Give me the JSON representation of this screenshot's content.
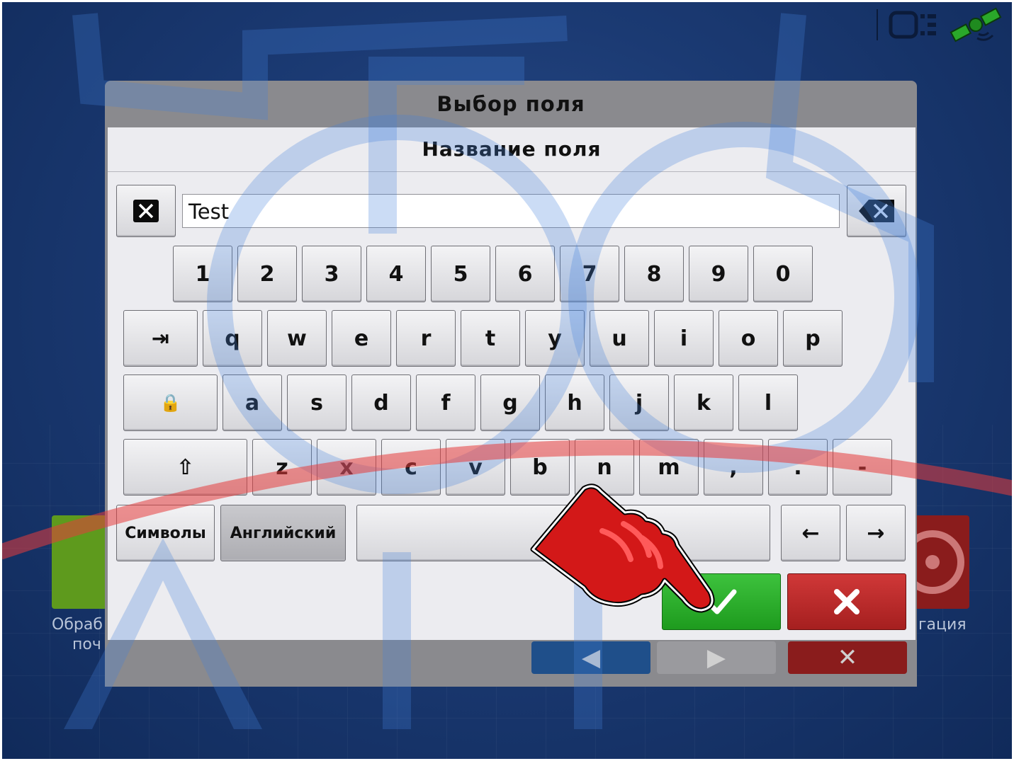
{
  "status_icons": [
    "display-icon",
    "satellite-signal-icon"
  ],
  "background": {
    "left_tile_label_line1": "Обраб",
    "left_tile_label_line2": "поч",
    "right_tile_label": "гация",
    "footer_prev_glyph": "◀",
    "footer_next_glyph": "▶",
    "footer_close_glyph": "✕"
  },
  "dialog": {
    "title": "Выбор поля",
    "subtitle": "Название поля",
    "input_value": "Test"
  },
  "keyboard": {
    "number_row": [
      "1",
      "2",
      "3",
      "4",
      "5",
      "6",
      "7",
      "8",
      "9",
      "0"
    ],
    "row_q": [
      "q",
      "w",
      "e",
      "r",
      "t",
      "y",
      "u",
      "i",
      "o",
      "p"
    ],
    "row_a": [
      "a",
      "s",
      "d",
      "f",
      "g",
      "h",
      "j",
      "k",
      "l"
    ],
    "row_z": [
      "z",
      "x",
      "c",
      "v",
      "b",
      "n",
      "m",
      ",",
      ".",
      "-"
    ],
    "symbols_label": "Символы",
    "language_label": "Английский",
    "tab_glyph": "⇥",
    "capslock_glyph": "🔒",
    "shift_glyph": "⇧",
    "left_arrow_glyph": "←",
    "right_arrow_glyph": "→"
  },
  "colors": {
    "ok": "#2db52d",
    "cancel": "#c02b2b",
    "background": "#1b3a73"
  }
}
